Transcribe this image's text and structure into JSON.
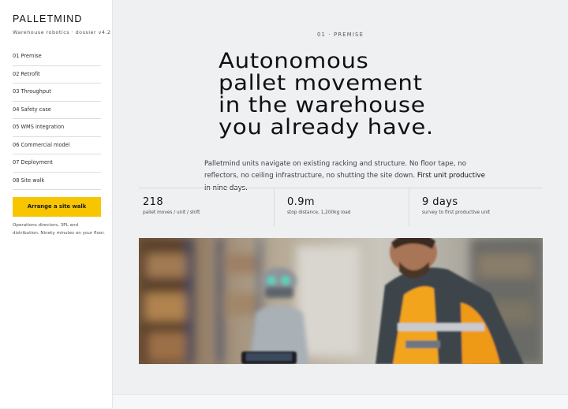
{
  "brand": {
    "name": "PALLETMIND",
    "subtitle": "Warehouse robotics · dossier v4.2"
  },
  "nav": {
    "items": [
      {
        "label": "01 Premise"
      },
      {
        "label": "02 Retrofit"
      },
      {
        "label": "03 Throughput"
      },
      {
        "label": "04 Safety case"
      },
      {
        "label": "05 WMS integration"
      },
      {
        "label": "06 Commercial model"
      },
      {
        "label": "07 Deployment"
      },
      {
        "label": "08 Site walk"
      }
    ]
  },
  "cta": {
    "label": "Arrange a site walk",
    "note": "Operations directors, 3PL and distribution. Ninety minutes on your floor."
  },
  "hero": {
    "eyebrow": "01 · PREMISE",
    "headline_lines": [
      "Autonomous",
      "pallet movement",
      "in the warehouse",
      "you already have."
    ],
    "lede": "Palletmind units navigate on existing racking and structure. No floor tape, no reflectors, no ceiling infrastructure, no shutting the site down.",
    "lede_emphasis": "First unit productive in nine days."
  },
  "stats": [
    {
      "value": "218",
      "label": "pallet moves / unit / shift"
    },
    {
      "value": "0.9m",
      "label": "stop distance, 1,200kg load"
    },
    {
      "value": "9 days",
      "label": "survey to first productive unit"
    }
  ],
  "colors": {
    "accent": "#f7c600",
    "page_bg": "#eef0f2",
    "sidebar_bg": "#ffffff",
    "text": "#1c1f24"
  }
}
